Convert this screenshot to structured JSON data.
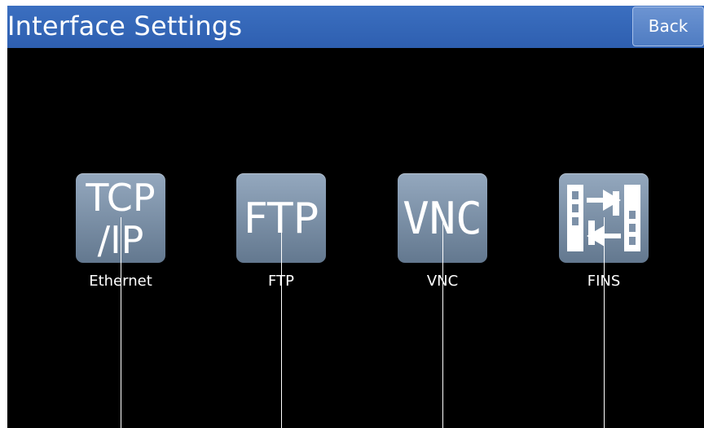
{
  "header": {
    "title": "Interface Settings",
    "back_label": "Back"
  },
  "tiles": [
    {
      "label": "Ethernet",
      "icon": "tcp-ip-icon",
      "icon_text_top": "TCP",
      "icon_text_bottom": "/IP"
    },
    {
      "label": "FTP",
      "icon": "ftp-icon",
      "icon_text": "FTP"
    },
    {
      "label": "VNC",
      "icon": "vnc-icon",
      "icon_text": "VNC"
    },
    {
      "label": "FINS",
      "icon": "fins-icon"
    }
  ],
  "colors": {
    "header_bg": "#2e5fb0",
    "screen_bg": "#000000",
    "tile_bg": "#7d91a8"
  }
}
